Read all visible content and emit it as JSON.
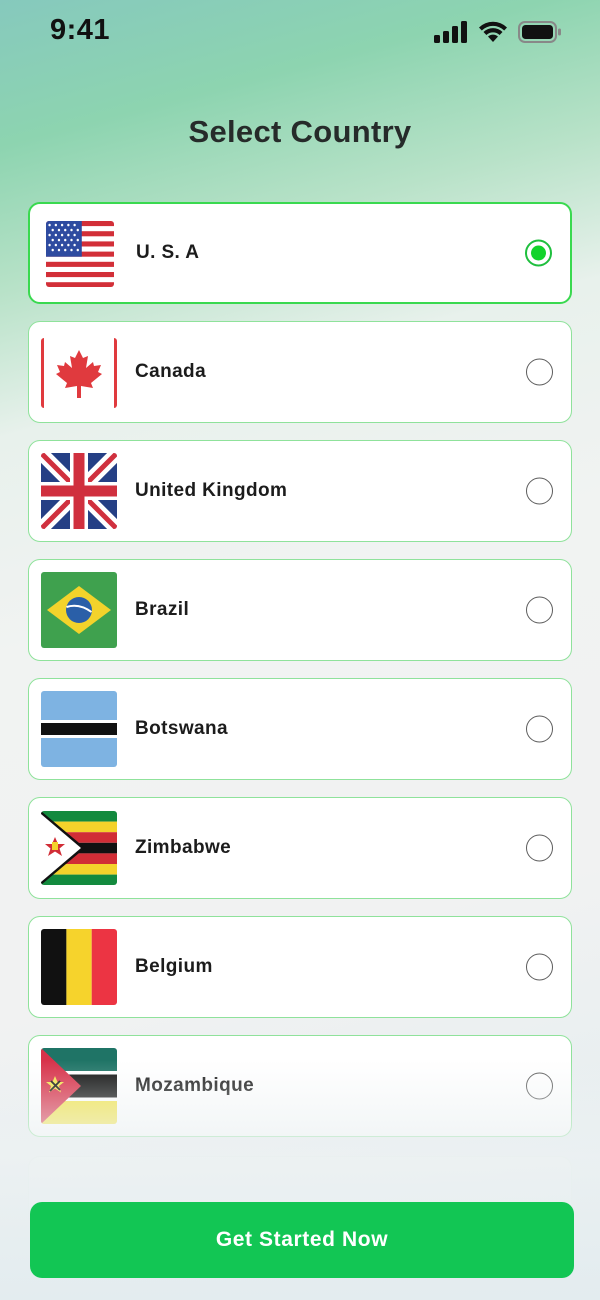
{
  "status_bar": {
    "time": "9:41"
  },
  "header": {
    "title": "Select Country"
  },
  "countries": [
    {
      "name": "U. S. A",
      "selected": true
    },
    {
      "name": "Canada",
      "selected": false
    },
    {
      "name": "United Kingdom",
      "selected": false
    },
    {
      "name": "Brazil",
      "selected": false
    },
    {
      "name": "Botswana",
      "selected": false
    },
    {
      "name": "Zimbabwe",
      "selected": false
    },
    {
      "name": "Belgium",
      "selected": false
    },
    {
      "name": "Mozambique",
      "selected": false
    }
  ],
  "footer": {
    "cta_label": "Get Started Now"
  },
  "colors": {
    "accent": "#12c654",
    "selected_dot": "#12d32b",
    "card_border": "#8fe29b"
  },
  "icons": [
    "cellular-signal-icon",
    "wifi-icon",
    "battery-icon",
    "radio-button-icon"
  ]
}
